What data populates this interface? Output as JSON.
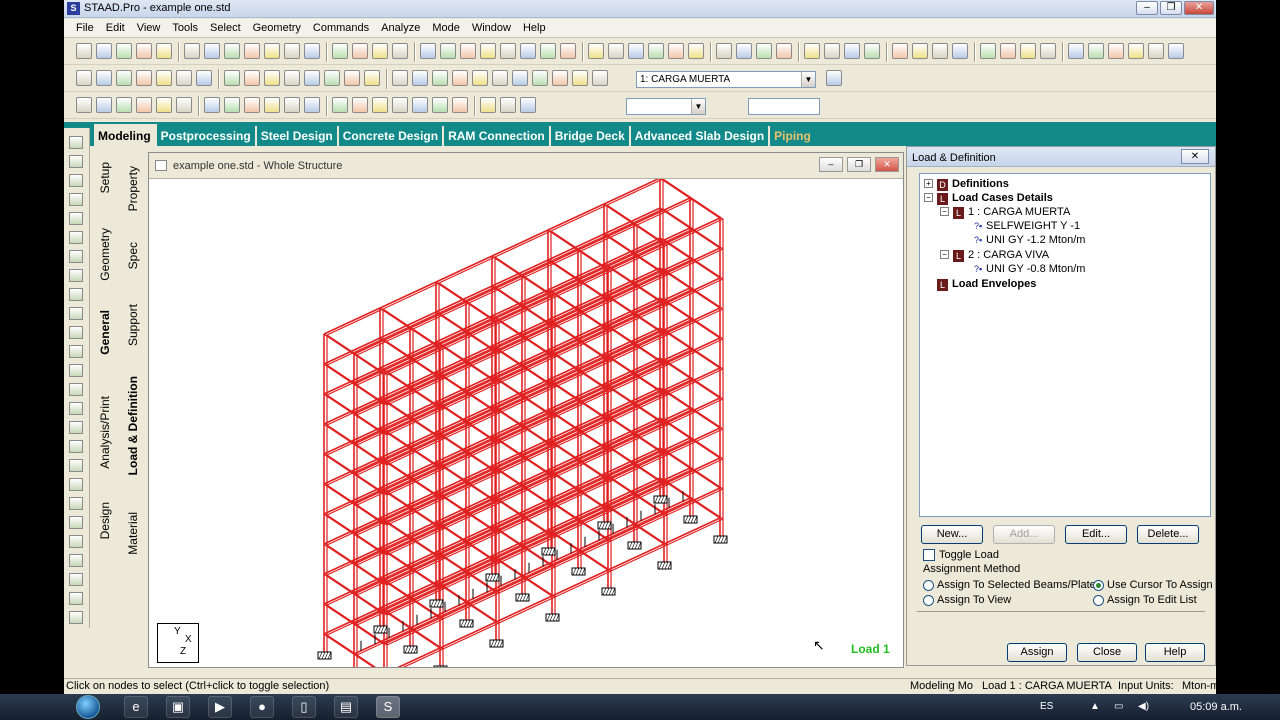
{
  "window": {
    "title": "STAAD.Pro - example one.std",
    "icon_label": "S"
  },
  "menu": [
    "File",
    "Edit",
    "View",
    "Tools",
    "Select",
    "Geometry",
    "Commands",
    "Analyze",
    "Mode",
    "Window",
    "Help"
  ],
  "load_dropdown": {
    "value": "1: CARGA MUERTA"
  },
  "modes": [
    {
      "label": "Modeling",
      "active": true
    },
    {
      "label": "Postprocessing"
    },
    {
      "label": "Steel Design"
    },
    {
      "label": "Concrete Design"
    },
    {
      "label": "RAM Connection"
    },
    {
      "label": "Bridge Deck"
    },
    {
      "label": "Advanced Slab Design"
    },
    {
      "label": "Piping"
    }
  ],
  "side_tabs": {
    "setup": "Setup",
    "geometry": "Geometry",
    "general": "General",
    "analysis": "Analysis/Print",
    "design": "Design",
    "property": "Property",
    "spec": "Spec",
    "support": "Support",
    "load": "Load & Definition",
    "material": "Material"
  },
  "viewport": {
    "title": "example one.std - Whole Structure",
    "load_label": "Load 1",
    "axes": {
      "y": "Y",
      "x": "X",
      "z": "Z"
    }
  },
  "panel": {
    "title": "Load & Definition",
    "tree": {
      "definitions": "Definitions",
      "load_cases": "Load Cases Details",
      "case1": "1 : CARGA MUERTA",
      "case1_items": [
        "SELFWEIGHT Y -1",
        "UNI GY -1.2 Mton/m"
      ],
      "case2": "2 : CARGA VIVA",
      "case2_items": [
        "UNI GY -0.8 Mton/m"
      ],
      "envelopes": "Load Envelopes"
    },
    "buttons": {
      "new": "New...",
      "add": "Add...",
      "edit": "Edit...",
      "delete": "Delete..."
    },
    "toggle_load": "Toggle Load",
    "assignment_method": "Assignment Method",
    "options": {
      "assign_beams": "Assign To Selected Beams/Plates",
      "use_cursor": "Use Cursor To Assign",
      "assign_view": "Assign To View",
      "assign_edit": "Assign To Edit List",
      "selected": "use_cursor"
    },
    "bottom_buttons": {
      "assign": "Assign",
      "close": "Close",
      "help": "Help"
    }
  },
  "status": {
    "hint": "Click on nodes to select (Ctrl+click to toggle selection)",
    "mode": "Modeling Mo",
    "load": "Load 1 : CARGA MUERTA",
    "units_label": "Input Units:",
    "units": "Mton-m"
  },
  "taskbar": {
    "lang": "ES",
    "time": "05:09 a.m."
  }
}
